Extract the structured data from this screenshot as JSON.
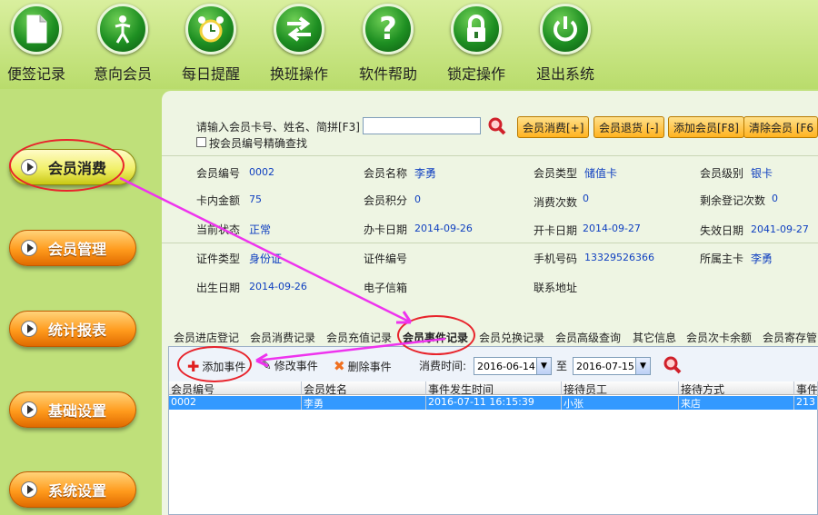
{
  "toolbar": {
    "items": [
      {
        "label": "便签记录",
        "icon": "note-icon"
      },
      {
        "label": "意向会员",
        "icon": "person-icon"
      },
      {
        "label": "每日提醒",
        "icon": "alarm-clock-icon"
      },
      {
        "label": "换班操作",
        "icon": "swap-arrows-icon"
      },
      {
        "label": "软件帮助",
        "icon": "question-icon"
      },
      {
        "label": "锁定操作",
        "icon": "lock-icon"
      },
      {
        "label": "退出系统",
        "icon": "power-icon"
      }
    ]
  },
  "side_menu": {
    "items": [
      {
        "label": "会员消费",
        "active": true
      },
      {
        "label": "会员管理"
      },
      {
        "label": "统计报表"
      },
      {
        "label": "基础设置"
      },
      {
        "label": "系统设置"
      }
    ]
  },
  "search": {
    "label": "请输入会员卡号、姓名、简拼[F3]",
    "value": "",
    "exact_label": "按会员编号精确查找"
  },
  "actions": {
    "consume": "会员消费[+]",
    "return": "会员退货 [-]",
    "add": "添加会员[F8]",
    "clear": "清除会员 [F6"
  },
  "member": {
    "id_label": "会员编号",
    "id": "0002",
    "name_label": "会员名称",
    "name": "李勇",
    "type_label": "会员类型",
    "type": "储值卡",
    "level_label": "会员级别",
    "level": "银卡",
    "balance_label": "卡内金额",
    "balance": "75",
    "points_label": "会员积分",
    "points": "0",
    "visits_label": "消费次数",
    "visits": "0",
    "remaining_label": "剩余登记次数",
    "remaining": "0",
    "status_label": "当前状态",
    "status": "正常",
    "issue_label": "办卡日期",
    "issue": "2014-09-26",
    "open_label": "开卡日期",
    "open": "2014-09-27",
    "expire_label": "失效日期",
    "expire": "2041-09-27",
    "idtype_label": "证件类型",
    "idtype": "身份证",
    "idnum_label": "证件编号",
    "idnum": "",
    "phone_label": "手机号码",
    "phone": "13329526366",
    "owner_label": "所属主卡",
    "owner": "李勇",
    "birth_label": "出生日期",
    "birth": "2014-09-26",
    "email_label": "电子信箱",
    "addr_label": "联系地址"
  },
  "tabs": [
    "会员进店登记",
    "会员消费记录",
    "会员充值记录",
    "会员事件记录",
    "会员兑换记录",
    "会员高级查询",
    "其它信息",
    "会员次卡余额",
    "会员寄存管"
  ],
  "grid_toolbar": {
    "add": "添加事件",
    "edit": "修改事件",
    "delete": "删除事件",
    "time_label": "消费时间:",
    "from": "2016-06-14",
    "to_label": "至",
    "to": "2016-07-15"
  },
  "table": {
    "headers": [
      "会员编号",
      "会员姓名",
      "事件发生时间",
      "接待员工",
      "接待方式",
      "事件"
    ],
    "rows": [
      [
        "0002",
        "李勇",
        "2016-07-11 16:15:39",
        "小张",
        "来店",
        "213"
      ]
    ]
  },
  "colors": {
    "annotation": "#e8232b",
    "arrow": "#ee33ee",
    "selection": "#3399ff"
  }
}
